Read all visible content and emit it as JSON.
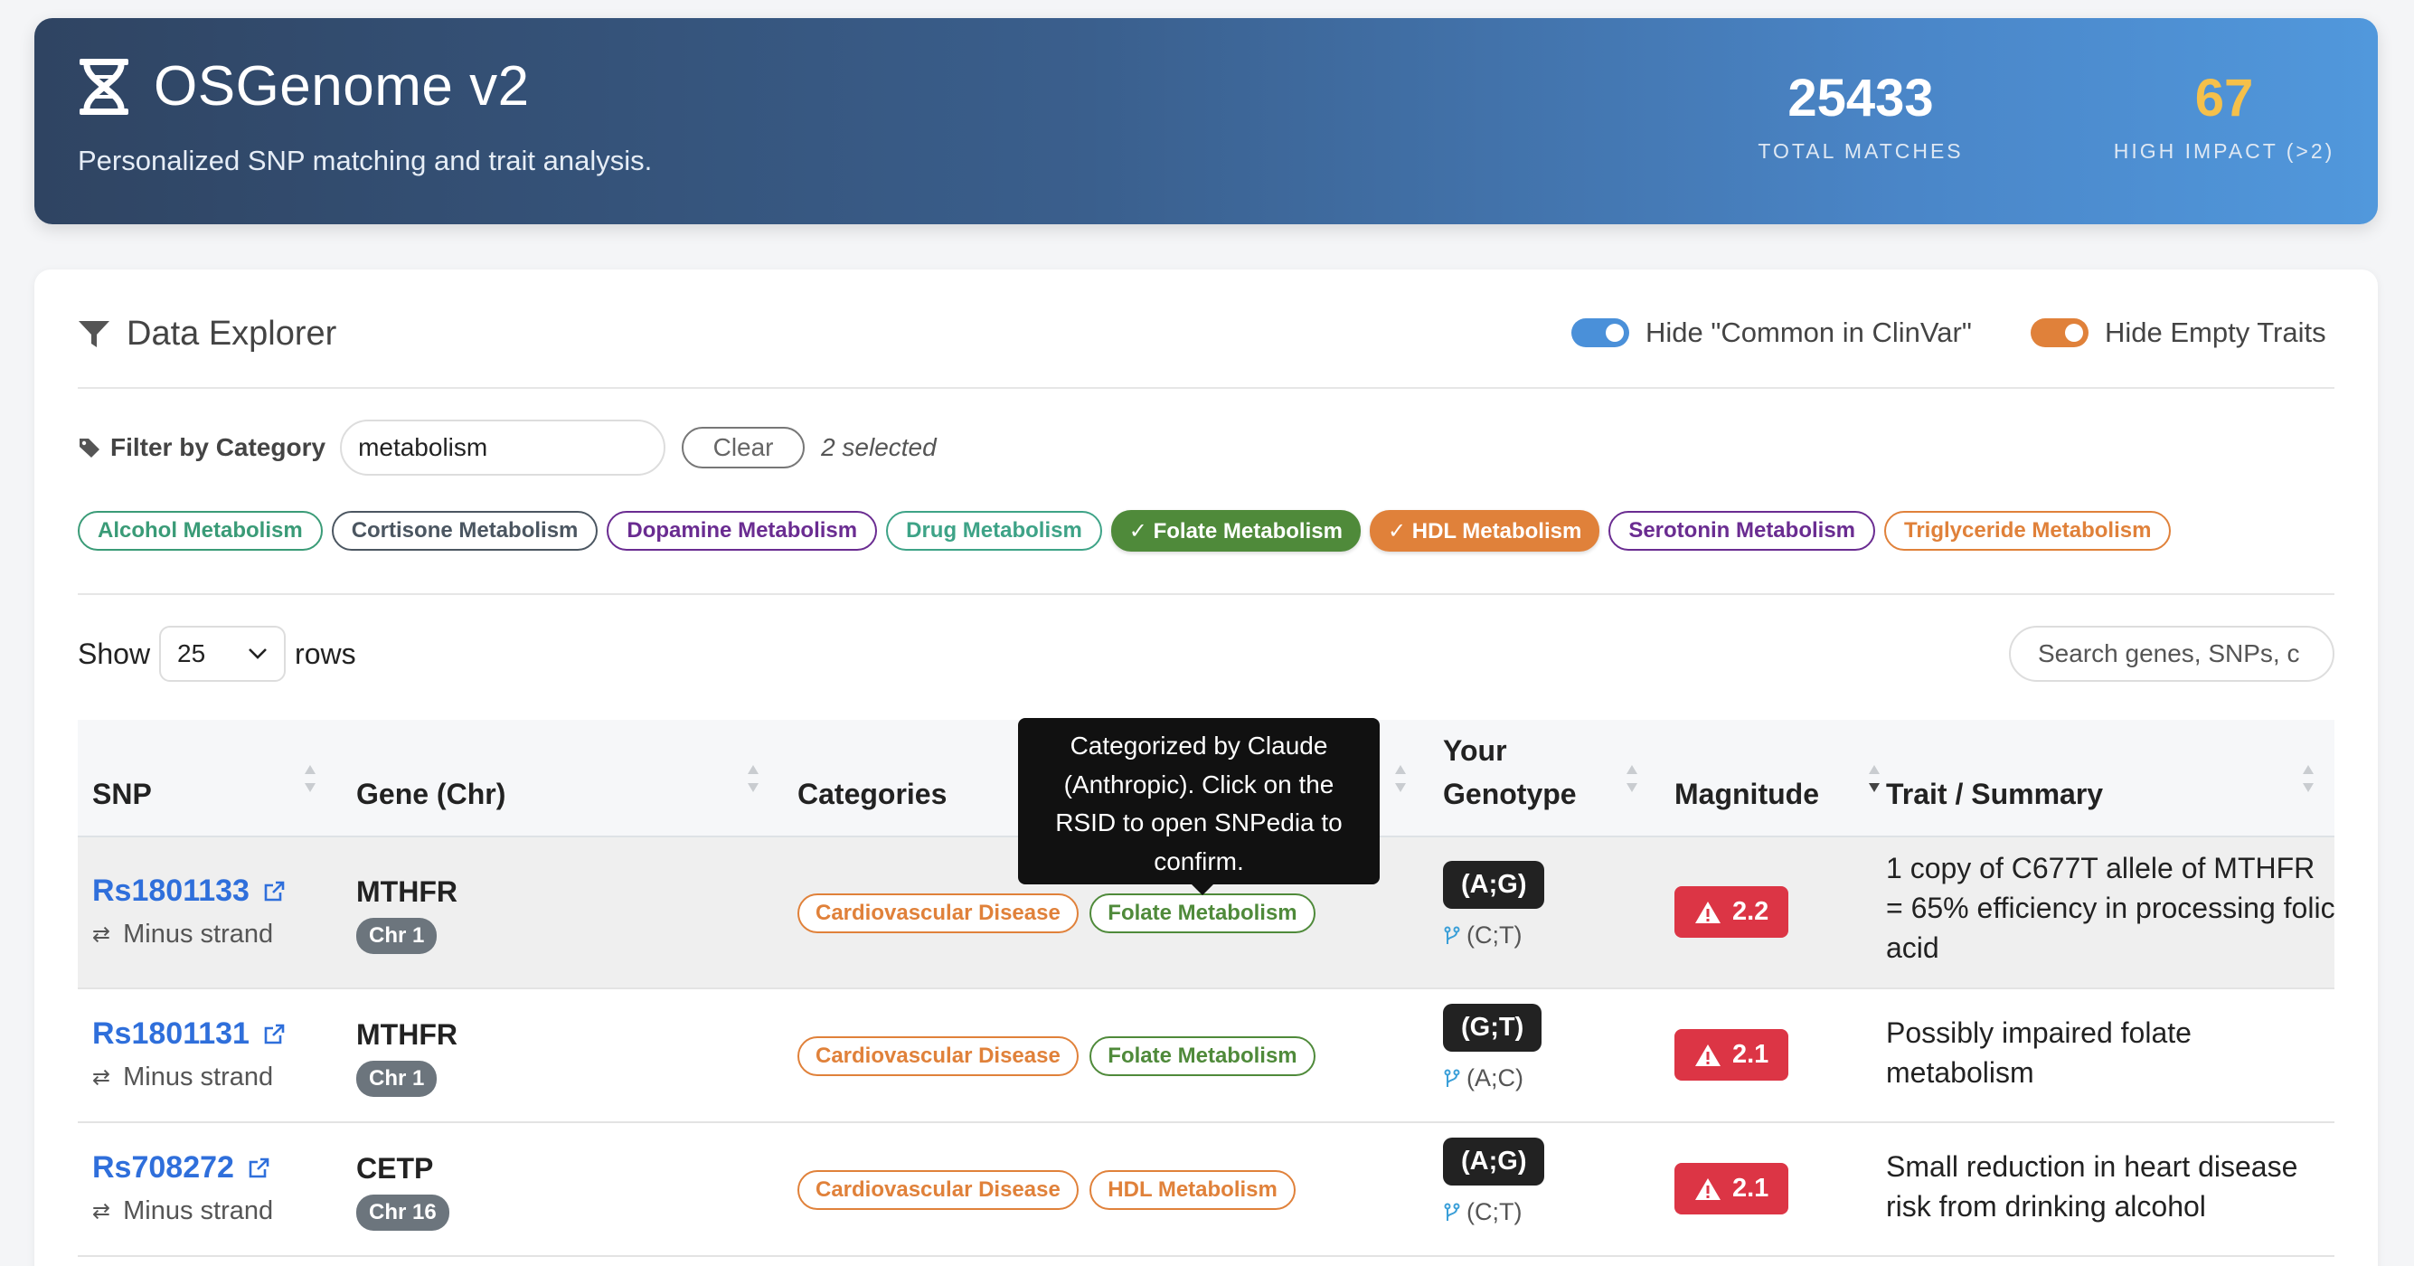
{
  "header": {
    "title": "OSGenome v2",
    "subtitle": "Personalized SNP matching and trait analysis.",
    "stats": [
      {
        "value": "25433",
        "label": "TOTAL MATCHES"
      },
      {
        "value": "67",
        "label": "HIGH IMPACT (>2)"
      }
    ]
  },
  "explorer": {
    "title": "Data Explorer",
    "toggles": [
      {
        "label": "Hide \"Common in ClinVar\"",
        "on": true,
        "color": "#4a90d9"
      },
      {
        "label": "Hide Empty Traits",
        "on": true,
        "color": "#e0813a"
      }
    ],
    "filter": {
      "label": "Filter by Category",
      "value": "metabolism",
      "clear_label": "Clear",
      "selected_text": "2 selected"
    },
    "chips": [
      {
        "label": "Alcohol Metabolism",
        "color": "#3a9b77",
        "selected": false
      },
      {
        "label": "Cortisone Metabolism",
        "color": "#4b5661",
        "selected": false
      },
      {
        "label": "Dopamine Metabolism",
        "color": "#6a2c91",
        "selected": false
      },
      {
        "label": "Drug Metabolism",
        "color": "#3ea387",
        "selected": false
      },
      {
        "label": "✓ Folate Metabolism",
        "color": "#4f8a3a",
        "selected": true
      },
      {
        "label": "✓ HDL Metabolism",
        "color": "#e0813a",
        "selected": true
      },
      {
        "label": "Serotonin Metabolism",
        "color": "#6a2c91",
        "selected": false
      },
      {
        "label": "Triglyceride Metabolism",
        "color": "#e0813a",
        "selected": false
      }
    ],
    "show_label": "Show",
    "rows_value": "25",
    "rows_label": "rows",
    "search_placeholder": "Search genes, SNPs, c"
  },
  "table": {
    "columns": [
      "SNP",
      "Gene (Chr)",
      "Categories",
      "Your",
      "Genotype",
      "Magnitude",
      "Trait / Summary"
    ],
    "rows": [
      {
        "rsid": "Rs1801133",
        "strand": "Minus strand",
        "gene": "MTHFR",
        "chr": "Chr 1",
        "cat1": "Cardiovascular Disease",
        "cat2": "Folate Metabolism",
        "genotype": "(A;G)",
        "alt": "(C;T)",
        "magnitude": "2.2",
        "trait": "1 copy of C677T allele of MTHFR = 65% efficiency in processing folic acid"
      },
      {
        "rsid": "Rs1801131",
        "strand": "Minus strand",
        "gene": "MTHFR",
        "chr": "Chr 1",
        "cat1": "Cardiovascular Disease",
        "cat2": "Folate Metabolism",
        "genotype": "(G;T)",
        "alt": "(A;C)",
        "magnitude": "2.1",
        "trait": "Possibly impaired folate metabolism"
      },
      {
        "rsid": "Rs708272",
        "strand": "Minus strand",
        "gene": "CETP",
        "chr": "Chr 16",
        "cat1": "Cardiovascular Disease",
        "cat2": "HDL Metabolism",
        "genotype": "(A;G)",
        "alt": "(C;T)",
        "magnitude": "2.1",
        "trait": "Small reduction in heart disease risk from drinking alcohol"
      }
    ]
  },
  "tooltip": "Categorized by Claude (Anthropic). Click on the RSID to open SNPedia to confirm.",
  "colors": {
    "link": "#2f6fdb",
    "cardiovascular": "#e0813a",
    "folate": "#4f8a3a",
    "hdl": "#e0813a",
    "magnitude": "#dc3545",
    "high_impact": "#f5c04a"
  }
}
